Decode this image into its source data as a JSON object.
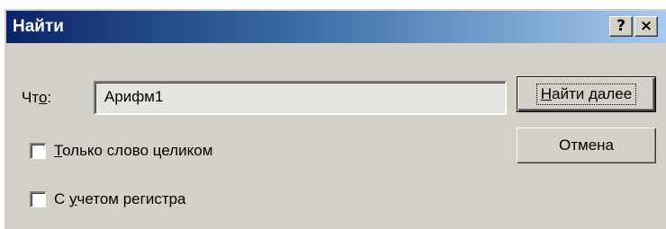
{
  "window": {
    "title": "Найти"
  },
  "titlebar_buttons": {
    "help": "?",
    "close": "×"
  },
  "find": {
    "label_pre": "Чт",
    "label_mnemonic": "о",
    "label_post": ":",
    "value": "Арифм1"
  },
  "buttons": {
    "find_next_mnemonic": "Н",
    "find_next_rest": "айти далее",
    "cancel": "Отмена"
  },
  "options": {
    "whole_word": {
      "mnemonic": "Т",
      "rest": "олько слово целиком",
      "checked": false
    },
    "match_case": {
      "pre": "С ",
      "mnemonic": "у",
      "rest": "четом регистра",
      "checked": false
    }
  },
  "colors": {
    "title_start": "#0a246a",
    "title_end": "#a6caf0",
    "face": "#d4d0c8"
  }
}
